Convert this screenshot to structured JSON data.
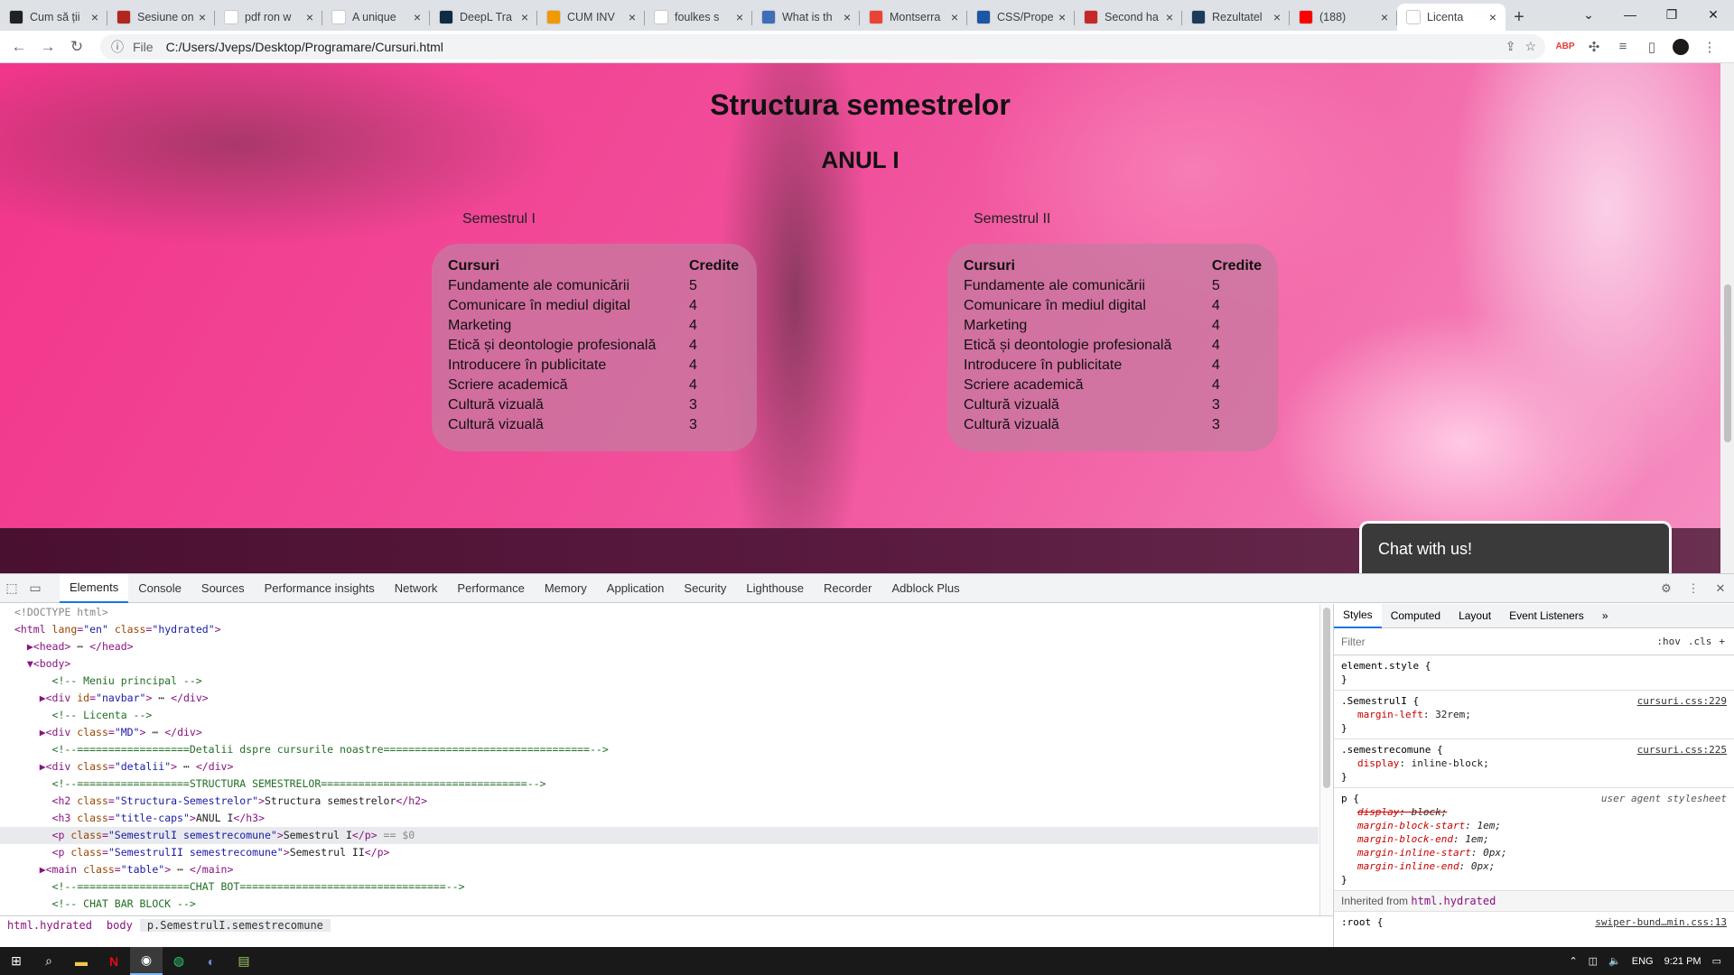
{
  "browser": {
    "tabs": [
      {
        "title": "Cum să ții",
        "icon_color": "#202124",
        "icon": "arrow-icon"
      },
      {
        "title": "Sesiune on",
        "icon_color": "#b3261e",
        "icon": "book-icon"
      },
      {
        "title": "pdf ron w",
        "icon_color": "#ffffff",
        "icon": "google-icon"
      },
      {
        "title": "A unique",
        "icon_color": "#ffffff",
        "icon": "wordpress-icon"
      },
      {
        "title": "DeepL Tra",
        "icon_color": "#0f2b46",
        "icon": "deepl-icon"
      },
      {
        "title": "CUM INV",
        "icon_color": "#f29900",
        "icon": "loading-icon"
      },
      {
        "title": "foulkes s",
        "icon_color": "#ffffff",
        "icon": "google-icon"
      },
      {
        "title": "What is th",
        "icon_color": "#3c6fb7",
        "icon": "quiz-icon"
      },
      {
        "title": "Montserra",
        "icon_color": "#ea4335",
        "icon": "grid-icon"
      },
      {
        "title": "CSS/Prope",
        "icon_color": "#1a56a5",
        "icon": "w3-icon"
      },
      {
        "title": "Second ha",
        "icon_color": "#c62828",
        "icon": "a-icon"
      },
      {
        "title": "Rezultatel",
        "icon_color": "#1b3a5c",
        "icon": "fl-icon"
      },
      {
        "title": "(188)",
        "icon_color": "#ff0000",
        "icon": "youtube-icon"
      },
      {
        "title": "Licenta",
        "icon_color": "#ffffff",
        "icon": "globe-icon"
      }
    ],
    "new_tab": "+",
    "url_prefix": "File",
    "url": "C:/Users/Jveps/Desktop/Programare/Cursuri.html"
  },
  "page": {
    "title": "Structura semestrelor",
    "year": "ANUL I",
    "semesters": [
      {
        "label": "Semestrul I",
        "col_courses": "Cursuri",
        "col_credits": "Credite",
        "rows": [
          {
            "course": "Fundamente ale comunicării",
            "credits": "5"
          },
          {
            "course": "Comunicare în mediul digital",
            "credits": "4"
          },
          {
            "course": "Marketing",
            "credits": "4"
          },
          {
            "course": "Etică și deontologie profesională",
            "credits": "4"
          },
          {
            "course": "Introducere în publicitate",
            "credits": "4"
          },
          {
            "course": "Scriere academică",
            "credits": "4"
          },
          {
            "course": "Cultură vizuală",
            "credits": "3"
          },
          {
            "course": "Cultură vizuală",
            "credits": "3"
          }
        ]
      },
      {
        "label": "Semestrul II",
        "col_courses": "Cursuri",
        "col_credits": "Credite",
        "rows": [
          {
            "course": "Fundamente ale comunicării",
            "credits": "5"
          },
          {
            "course": "Comunicare în mediul digital",
            "credits": "4"
          },
          {
            "course": "Marketing",
            "credits": "4"
          },
          {
            "course": "Etică și deontologie profesională",
            "credits": "4"
          },
          {
            "course": "Introducere în publicitate",
            "credits": "4"
          },
          {
            "course": "Scriere academică",
            "credits": "4"
          },
          {
            "course": "Cultură vizuală",
            "credits": "3"
          },
          {
            "course": "Cultură vizuală",
            "credits": "3"
          }
        ]
      }
    ],
    "chat_label": "Chat with us!"
  },
  "devtools": {
    "tabs": [
      "Elements",
      "Console",
      "Sources",
      "Performance insights",
      "Network",
      "Performance",
      "Memory",
      "Application",
      "Security",
      "Lighthouse",
      "Recorder",
      "Adblock Plus"
    ],
    "active_tab": "Elements",
    "dom_lines": [
      "<!DOCTYPE html>",
      "<html lang=\"en\" class=\"hydrated\">",
      "  ▶<head> ⋯ </head>",
      "  ▼<body>",
      "      <!-- Meniu principal -->",
      "    ▶<div id=\"navbar\"> ⋯ </div>",
      "      <!-- Licenta -->",
      "    ▶<div class=\"MD\"> ⋯ </div>",
      "      <!--==================Detalii dspre cursurile noastre=================================-->",
      "    ▶<div class=\"detalii\"> ⋯ </div>",
      "      <!--==================STRUCTURA SEMESTRELOR=================================-->",
      "      <h2 class=\"Structura-Semestrelor\">Structura semestrelor</h2>",
      "      <h3 class=\"title-caps\">ANUL I</h3>",
      "      <p class=\"SemestrulI semestrecomune\">Semestrul I</p> == $0",
      "      <p class=\"SemestrulII semestrecomune\">Semestrul II</p>",
      "    ▶<main class=\"table\"> ⋯ </main>",
      "      <!--==================CHAT BOT=================================-->",
      "      <!-- CHAT BAR BLOCK -->",
      "    ▶<div class=\"chat-bar-collapsible\"> ⋯ </div>"
    ],
    "selected_line": 13,
    "breadcrumbs": [
      "html.hydrated",
      "body",
      "p.SemestrulI.semestrecomune"
    ],
    "styles_tabs": [
      "Styles",
      "Computed",
      "Layout",
      "Event Listeners"
    ],
    "filter_placeholder": "Filter",
    "filter_opts": [
      ":hov",
      ".cls",
      "+"
    ],
    "rules": [
      {
        "selector": "element.style {",
        "source": "",
        "props": []
      },
      {
        "selector": ".SemestrulI {",
        "source": "cursuri.css:229",
        "props": [
          {
            "name": "margin-left",
            "value": "32rem;"
          }
        ]
      },
      {
        "selector": ".semestrecomune {",
        "source": "cursuri.css:225",
        "props": [
          {
            "name": "display",
            "value": "inline-block;"
          }
        ]
      },
      {
        "selector": "p {",
        "source": "user agent stylesheet",
        "props": [
          {
            "name": "display",
            "value": "block;",
            "strike": true
          },
          {
            "name": "margin-block-start",
            "value": "1em;"
          },
          {
            "name": "margin-block-end",
            "value": "1em;"
          },
          {
            "name": "margin-inline-start",
            "value": "0px;"
          },
          {
            "name": "margin-inline-end",
            "value": "0px;"
          }
        ]
      }
    ],
    "inherited_label": "Inherited from",
    "inherited_from": "html.hydrated",
    "root_selector": ":root {",
    "root_source": "swiper-bund…min.css:13"
  },
  "taskbar": {
    "lang": "ENG",
    "time": "9:21 PM"
  }
}
